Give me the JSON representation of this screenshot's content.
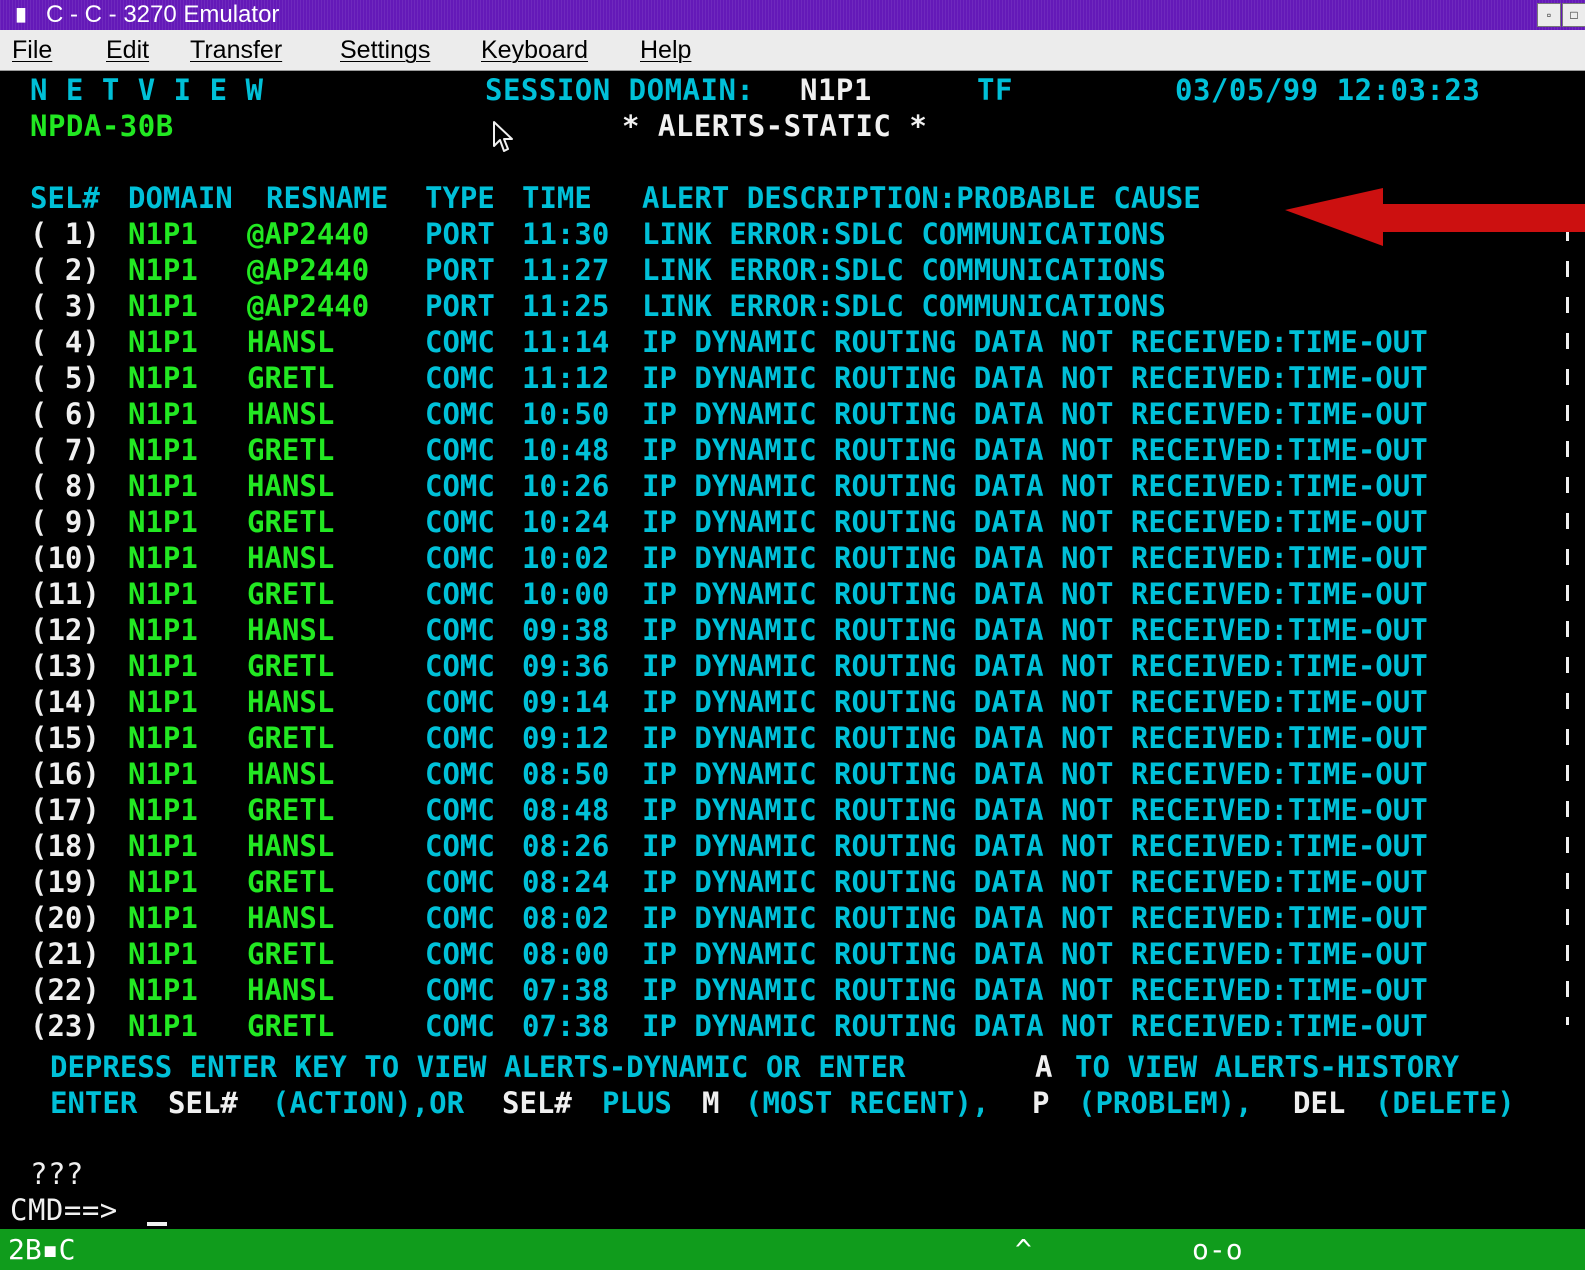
{
  "window": {
    "title": "C - C - 3270 Emulator",
    "system_icon": "3270-icon",
    "minimize_icon": "minimize-icon",
    "maximize_icon": "maximize-icon"
  },
  "menu": {
    "file": "File",
    "edit": "Edit",
    "transfer": "Transfer",
    "settings": "Settings",
    "keyboard": "Keyboard",
    "help": "Help"
  },
  "screen": {
    "netview": "N E T V I E W",
    "session_domain_label": "SESSION DOMAIN:",
    "session_domain": "N1P1",
    "operator": "TF",
    "datetime": "03/05/99 12:03:23",
    "panel_id": "NPDA-30B",
    "panel_title": "* ALERTS-STATIC *",
    "headers": {
      "sel": "SEL#",
      "domain": "DOMAIN",
      "resname": "RESNAME",
      "type": "TYPE",
      "time": "TIME",
      "description": "ALERT DESCRIPTION:PROBABLE CAUSE"
    },
    "rows": [
      {
        "sel": "( 1)",
        "domain": "N1P1",
        "resname": "@AP2440",
        "type": "PORT",
        "time": "11:30",
        "description": "LINK ERROR:SDLC COMMUNICATIONS"
      },
      {
        "sel": "( 2)",
        "domain": "N1P1",
        "resname": "@AP2440",
        "type": "PORT",
        "time": "11:27",
        "description": "LINK ERROR:SDLC COMMUNICATIONS"
      },
      {
        "sel": "( 3)",
        "domain": "N1P1",
        "resname": "@AP2440",
        "type": "PORT",
        "time": "11:25",
        "description": "LINK ERROR:SDLC COMMUNICATIONS"
      },
      {
        "sel": "( 4)",
        "domain": "N1P1",
        "resname": "HANSL",
        "type": "COMC",
        "time": "11:14",
        "description": "IP DYNAMIC ROUTING DATA NOT RECEIVED:TIME-OUT"
      },
      {
        "sel": "( 5)",
        "domain": "N1P1",
        "resname": "GRETL",
        "type": "COMC",
        "time": "11:12",
        "description": "IP DYNAMIC ROUTING DATA NOT RECEIVED:TIME-OUT"
      },
      {
        "sel": "( 6)",
        "domain": "N1P1",
        "resname": "HANSL",
        "type": "COMC",
        "time": "10:50",
        "description": "IP DYNAMIC ROUTING DATA NOT RECEIVED:TIME-OUT"
      },
      {
        "sel": "( 7)",
        "domain": "N1P1",
        "resname": "GRETL",
        "type": "COMC",
        "time": "10:48",
        "description": "IP DYNAMIC ROUTING DATA NOT RECEIVED:TIME-OUT"
      },
      {
        "sel": "( 8)",
        "domain": "N1P1",
        "resname": "HANSL",
        "type": "COMC",
        "time": "10:26",
        "description": "IP DYNAMIC ROUTING DATA NOT RECEIVED:TIME-OUT"
      },
      {
        "sel": "( 9)",
        "domain": "N1P1",
        "resname": "GRETL",
        "type": "COMC",
        "time": "10:24",
        "description": "IP DYNAMIC ROUTING DATA NOT RECEIVED:TIME-OUT"
      },
      {
        "sel": "(10)",
        "domain": "N1P1",
        "resname": "HANSL",
        "type": "COMC",
        "time": "10:02",
        "description": "IP DYNAMIC ROUTING DATA NOT RECEIVED:TIME-OUT"
      },
      {
        "sel": "(11)",
        "domain": "N1P1",
        "resname": "GRETL",
        "type": "COMC",
        "time": "10:00",
        "description": "IP DYNAMIC ROUTING DATA NOT RECEIVED:TIME-OUT"
      },
      {
        "sel": "(12)",
        "domain": "N1P1",
        "resname": "HANSL",
        "type": "COMC",
        "time": "09:38",
        "description": "IP DYNAMIC ROUTING DATA NOT RECEIVED:TIME-OUT"
      },
      {
        "sel": "(13)",
        "domain": "N1P1",
        "resname": "GRETL",
        "type": "COMC",
        "time": "09:36",
        "description": "IP DYNAMIC ROUTING DATA NOT RECEIVED:TIME-OUT"
      },
      {
        "sel": "(14)",
        "domain": "N1P1",
        "resname": "HANSL",
        "type": "COMC",
        "time": "09:14",
        "description": "IP DYNAMIC ROUTING DATA NOT RECEIVED:TIME-OUT"
      },
      {
        "sel": "(15)",
        "domain": "N1P1",
        "resname": "GRETL",
        "type": "COMC",
        "time": "09:12",
        "description": "IP DYNAMIC ROUTING DATA NOT RECEIVED:TIME-OUT"
      },
      {
        "sel": "(16)",
        "domain": "N1P1",
        "resname": "HANSL",
        "type": "COMC",
        "time": "08:50",
        "description": "IP DYNAMIC ROUTING DATA NOT RECEIVED:TIME-OUT"
      },
      {
        "sel": "(17)",
        "domain": "N1P1",
        "resname": "GRETL",
        "type": "COMC",
        "time": "08:48",
        "description": "IP DYNAMIC ROUTING DATA NOT RECEIVED:TIME-OUT"
      },
      {
        "sel": "(18)",
        "domain": "N1P1",
        "resname": "HANSL",
        "type": "COMC",
        "time": "08:26",
        "description": "IP DYNAMIC ROUTING DATA NOT RECEIVED:TIME-OUT"
      },
      {
        "sel": "(19)",
        "domain": "N1P1",
        "resname": "GRETL",
        "type": "COMC",
        "time": "08:24",
        "description": "IP DYNAMIC ROUTING DATA NOT RECEIVED:TIME-OUT"
      },
      {
        "sel": "(20)",
        "domain": "N1P1",
        "resname": "HANSL",
        "type": "COMC",
        "time": "08:02",
        "description": "IP DYNAMIC ROUTING DATA NOT RECEIVED:TIME-OUT"
      },
      {
        "sel": "(21)",
        "domain": "N1P1",
        "resname": "GRETL",
        "type": "COMC",
        "time": "08:00",
        "description": "IP DYNAMIC ROUTING DATA NOT RECEIVED:TIME-OUT"
      },
      {
        "sel": "(22)",
        "domain": "N1P1",
        "resname": "HANSL",
        "type": "COMC",
        "time": "07:38",
        "description": "IP DYNAMIC ROUTING DATA NOT RECEIVED:TIME-OUT"
      },
      {
        "sel": "(23)",
        "domain": "N1P1",
        "resname": "GRETL",
        "type": "COMC",
        "time": "07:38",
        "description": "IP DYNAMIC ROUTING DATA NOT RECEIVED:TIME-OUT"
      }
    ],
    "instructions": {
      "line1_a": "DEPRESS ENTER KEY TO VIEW ALERTS-DYNAMIC OR ENTER",
      "line1_key": "A",
      "line1_b": "TO VIEW ALERTS-HISTORY",
      "line2_a": "ENTER",
      "line2_k1": "SEL#",
      "line2_b": "(ACTION),OR",
      "line2_k2": "SEL#",
      "line2_c": "PLUS",
      "line2_k3": "M",
      "line2_d": "(MOST RECENT),",
      "line2_k4": "P",
      "line2_e": "(PROBLEM),",
      "line2_k5": "DEL",
      "line2_f": "(DELETE)"
    },
    "message": "???",
    "command_prompt": "CMD==>",
    "command_value": ""
  },
  "status_bar": {
    "session": "2B▪C",
    "indicator": "^",
    "position": "o-o"
  },
  "colors": {
    "cyan": "#00c0d8",
    "green": "#22e822",
    "white": "#f0f0f0",
    "titlebar": "#6419b8",
    "statusbar": "#109c1c",
    "arrow": "#cc1010"
  }
}
